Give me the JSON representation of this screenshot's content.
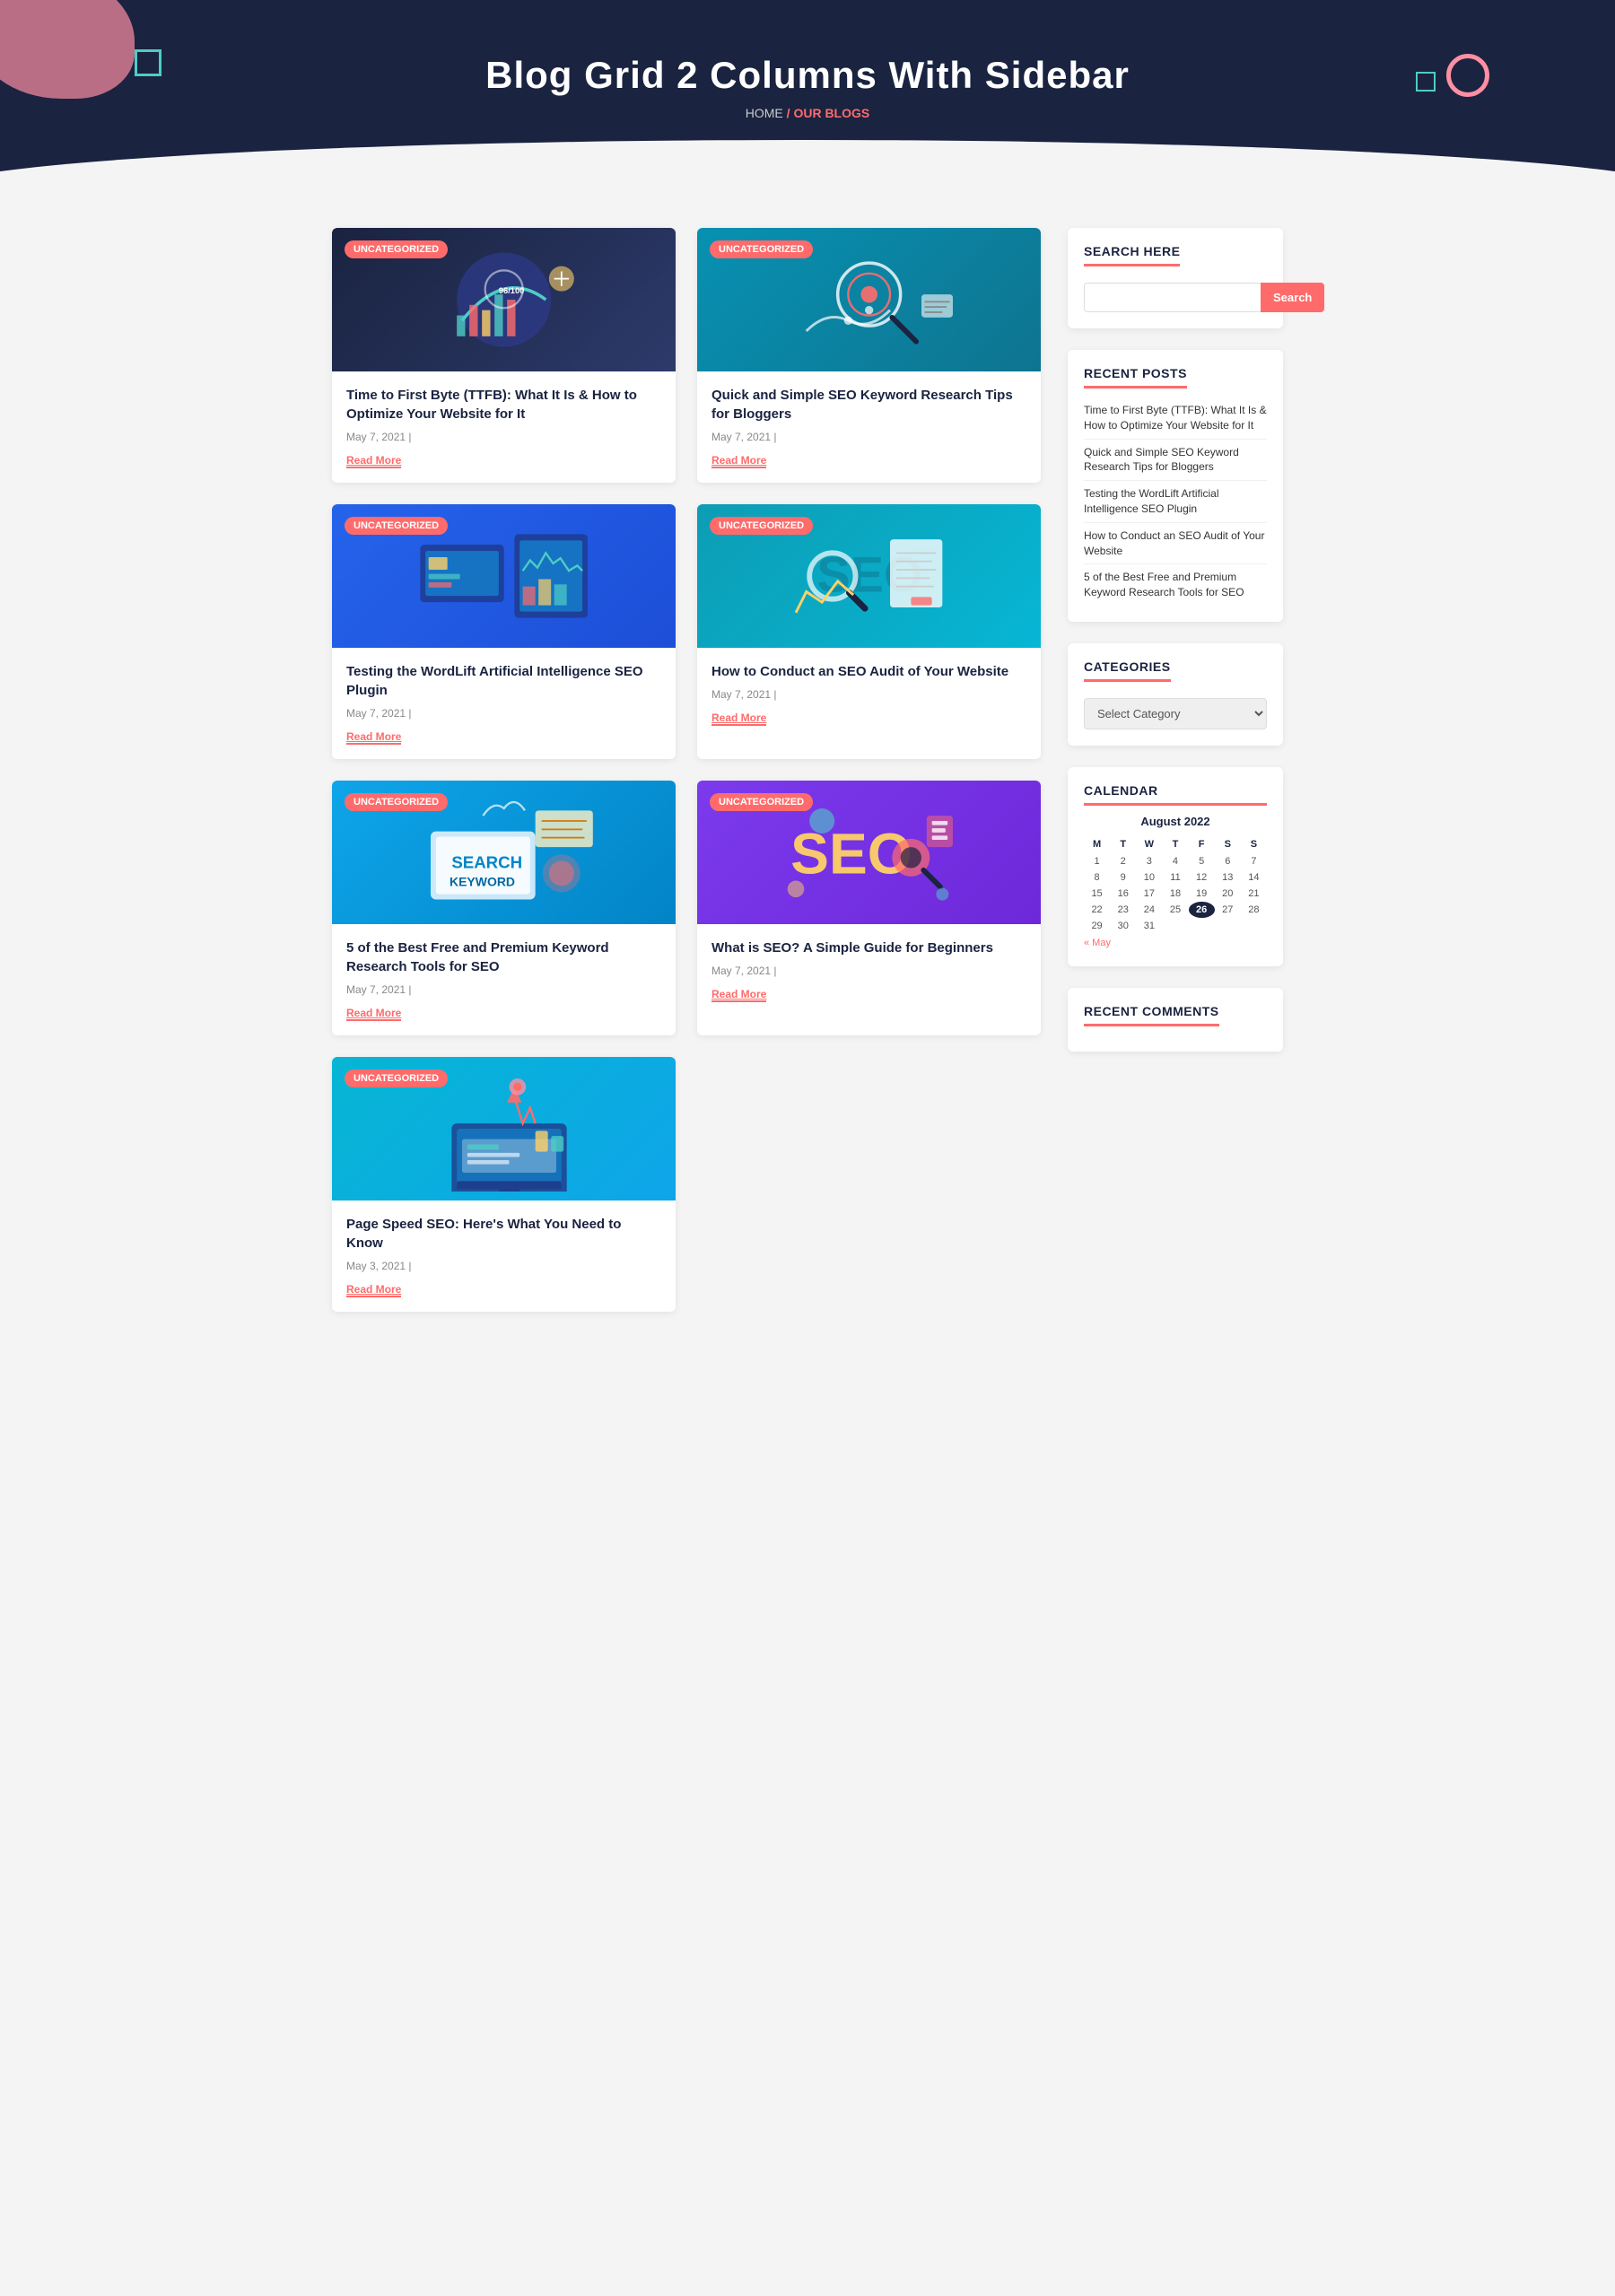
{
  "header": {
    "title": "Blog Grid 2 Columns With Sidebar",
    "breadcrumb_home": "HOME",
    "breadcrumb_sep": "/",
    "breadcrumb_current": "OUR BLOGS"
  },
  "posts": [
    {
      "id": "post1",
      "tag": "Uncategorized",
      "title": "Time to First Byte (TTFB): What It Is & How to Optimize Your Website for It",
      "date": "May 7, 2021 |",
      "readmore": "Read More",
      "img_type": "ttfb"
    },
    {
      "id": "post2",
      "tag": "Uncategorized",
      "title": "Quick and Simple SEO Keyword Research Tips for Bloggers",
      "date": "May 7, 2021 |",
      "readmore": "Read More",
      "img_type": "keyword"
    },
    {
      "id": "post3",
      "tag": "Uncategorized",
      "title": "Testing the WordLift Artificial Intelligence SEO Plugin",
      "date": "May 7, 2021 |",
      "readmore": "Read More",
      "img_type": "wordlift"
    },
    {
      "id": "post4",
      "tag": "Uncategorized",
      "title": "How to Conduct an SEO Audit of Your Website",
      "date": "May 7, 2021 |",
      "readmore": "Read More",
      "img_type": "seo-audit"
    },
    {
      "id": "post5",
      "tag": "Uncategorized",
      "title": "5 of the Best Free and Premium Keyword Research Tools for SEO",
      "date": "May 7, 2021 |",
      "readmore": "Read More",
      "img_type": "5best"
    },
    {
      "id": "post6",
      "tag": "Uncategorized",
      "title": "What is SEO? A Simple Guide for Beginners",
      "date": "May 7, 2021 |",
      "readmore": "Read More",
      "img_type": "whatseo"
    },
    {
      "id": "post7",
      "tag": "Uncategorized",
      "title": "Page Speed SEO: Here's What You Need to Know",
      "date": "May 3, 2021 |",
      "readmore": "Read More",
      "img_type": "pagespeed"
    }
  ],
  "sidebar": {
    "search_title": "SEARCH HERE",
    "search_placeholder": "",
    "search_btn": "Search",
    "recent_title": "RECENT POSTS",
    "recent_posts": [
      "Time to First Byte (TTFB): What It Is & How to Optimize Your Website for It",
      "Quick and Simple SEO Keyword Research Tips for Bloggers",
      "Testing the WordLift Artificial Intelligence SEO Plugin",
      "How to Conduct an SEO Audit of Your Website",
      "5 of the Best Free and Premium Keyword Research Tools for SEO"
    ],
    "categories_title": "CATEGORIES",
    "category_default": "Select Category",
    "calendar_title": "CALENDAR",
    "calendar_month": "August 2022",
    "calendar_headers": [
      "M",
      "T",
      "W",
      "T",
      "F",
      "S",
      "S"
    ],
    "calendar_weeks": [
      [
        "1",
        "2",
        "3",
        "4",
        "5",
        "6",
        "7"
      ],
      [
        "8",
        "9",
        "10",
        "11",
        "12",
        "13",
        "14"
      ],
      [
        "15",
        "16",
        "17",
        "18",
        "19",
        "20",
        "21"
      ],
      [
        "22",
        "23",
        "24",
        "25",
        "26",
        "27",
        "28"
      ],
      [
        "29",
        "30",
        "31",
        "",
        "",
        "",
        ""
      ]
    ],
    "calendar_highlight": "26",
    "calendar_prev": "« May",
    "recent_comments_title": "RECENT COMMENTS"
  }
}
